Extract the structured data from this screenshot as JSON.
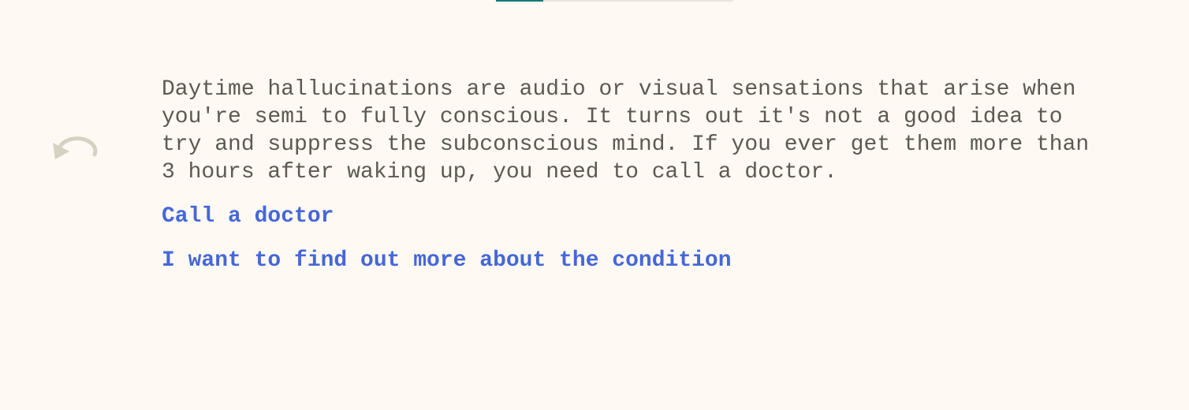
{
  "progress": {
    "value": 0.2,
    "fill_color": "#137a73",
    "track_color": "#e8e6e1"
  },
  "undo": {
    "icon": "undo-arrow-icon",
    "color": "#d6d2c2"
  },
  "story": {
    "passage": "Daytime hallucinations are audio or visual sensations that arise when you're semi to fully conscious. It turns out it's not a good idea to try and suppress the subconscious mind. If you ever get them more than 3 hours after waking up, you need to call a doctor.",
    "choices": [
      {
        "label": "Call a doctor"
      },
      {
        "label": "I want to find out more about the condition"
      }
    ]
  },
  "colors": {
    "background": "#fef9f3",
    "text": "#5c5a50",
    "link": "#4567d8"
  }
}
